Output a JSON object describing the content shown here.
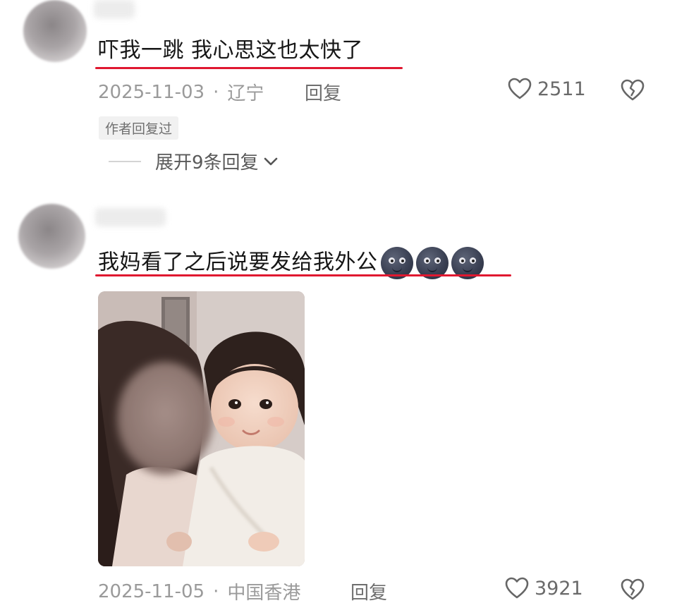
{
  "comments": [
    {
      "text": "吓我一跳 我心思这也太快了",
      "date": "2025-11-03",
      "location": "辽宁",
      "separator": "·",
      "reply_label": "回复",
      "likes": "2511",
      "author_tag": "作者回复过",
      "expand_label": "展开9条回复"
    },
    {
      "text": "我妈看了之后说要发给我外公",
      "emoji_count": 3,
      "date": "2025-11-05",
      "location": "中国香港",
      "separator": "·",
      "reply_label": "回复",
      "likes": "3921"
    }
  ],
  "colors": {
    "underline": "#e01830",
    "meta_text": "#9a9a9a",
    "tag_bg": "#f1f1f1"
  },
  "icons": [
    "heart-icon",
    "broken-heart-icon",
    "chevron-down-icon",
    "moon-face-emoji"
  ]
}
